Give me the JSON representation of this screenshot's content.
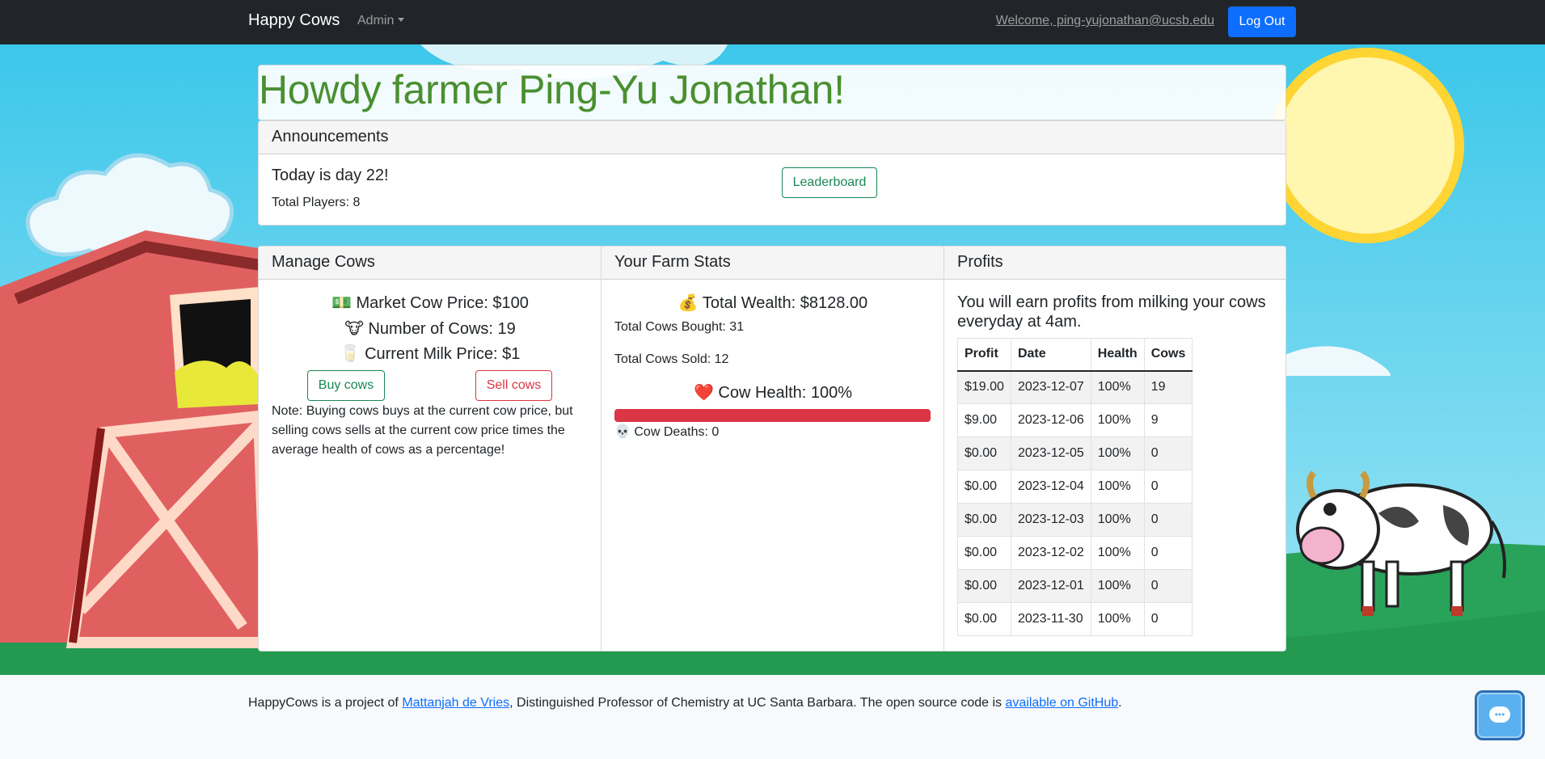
{
  "navbar": {
    "brand": "Happy Cows",
    "admin_label": "Admin",
    "welcome": "Welcome, ping-yujonathan@ucsb.edu",
    "logout_label": "Log Out"
  },
  "greeting": "Howdy farmer Ping-Yu Jonathan!",
  "announcements": {
    "header": "Announcements",
    "day_text": "Today is day 22!",
    "players_text": "Total Players: 8",
    "leaderboard_label": "Leaderboard"
  },
  "manage": {
    "header": "Manage Cows",
    "market_price": "💵 Market Cow Price: $100",
    "num_cows": "🐮 Number of Cows: 19",
    "milk_price": "🥛 Current Milk Price: $1",
    "buy_label": "Buy cows",
    "sell_label": "Sell cows",
    "note": "Note: Buying cows buys at the current cow price, but selling cows sells at the current cow price times the average health of cows as a percentage!"
  },
  "stats": {
    "header": "Your Farm Stats",
    "wealth": "💰 Total Wealth: $8128.00",
    "bought": "Total Cows Bought: 31",
    "sold": "Total Cows Sold: 12",
    "health": "❤️ Cow Health: 100%",
    "health_fraction": 1.0,
    "deaths": "💀 Cow Deaths: 0"
  },
  "profits": {
    "header": "Profits",
    "text": "You will earn profits from milking your cows everyday at 4am.",
    "columns": [
      "Profit",
      "Date",
      "Health",
      "Cows"
    ],
    "rows": [
      [
        "$19.00",
        "2023-12-07",
        "100%",
        "19"
      ],
      [
        "$9.00",
        "2023-12-06",
        "100%",
        "9"
      ],
      [
        "$0.00",
        "2023-12-05",
        "100%",
        "0"
      ],
      [
        "$0.00",
        "2023-12-04",
        "100%",
        "0"
      ],
      [
        "$0.00",
        "2023-12-03",
        "100%",
        "0"
      ],
      [
        "$0.00",
        "2023-12-02",
        "100%",
        "0"
      ],
      [
        "$0.00",
        "2023-12-01",
        "100%",
        "0"
      ],
      [
        "$0.00",
        "2023-11-30",
        "100%",
        "0"
      ]
    ]
  },
  "footer": {
    "prefix": "HappyCows is a project of ",
    "author_link": "Mattanjah de Vries",
    "middle": ", Distinguished Professor of Chemistry at UC Santa Barbara. The open source code is ",
    "github_link": "available on GitHub",
    "suffix": "."
  },
  "colors": {
    "navbar": "#212529",
    "primary": "#0d6efd",
    "success": "#198754",
    "danger": "#dc3545",
    "greeting": "#4a8f30"
  },
  "icons": [
    "chevron-down-icon",
    "chat-icon"
  ]
}
